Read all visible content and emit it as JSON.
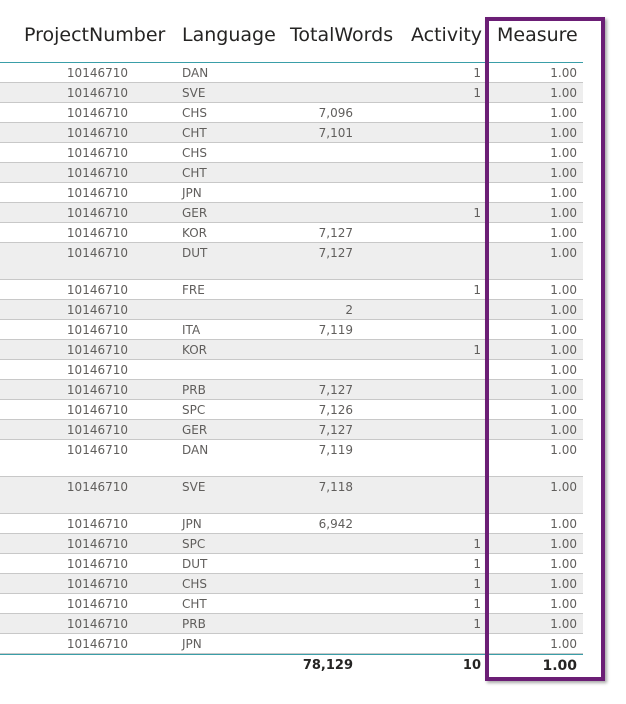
{
  "table": {
    "columns": {
      "project_number": "ProjectNumber",
      "language": "Language",
      "total_words": "TotalWords",
      "activity": "Activity",
      "measure": "Measure"
    },
    "rows": [
      {
        "project": "10146710",
        "language": "DAN",
        "words": "",
        "activity": "1",
        "measure": "1.00",
        "tall": false
      },
      {
        "project": "10146710",
        "language": "SVE",
        "words": "",
        "activity": "1",
        "measure": "1.00",
        "tall": false
      },
      {
        "project": "10146710",
        "language": "CHS",
        "words": "7,096",
        "activity": "",
        "measure": "1.00",
        "tall": false
      },
      {
        "project": "10146710",
        "language": "CHT",
        "words": "7,101",
        "activity": "",
        "measure": "1.00",
        "tall": false
      },
      {
        "project": "10146710",
        "language": "CHS",
        "words": "",
        "activity": "",
        "measure": "1.00",
        "tall": false
      },
      {
        "project": "10146710",
        "language": "CHT",
        "words": "",
        "activity": "",
        "measure": "1.00",
        "tall": false
      },
      {
        "project": "10146710",
        "language": "JPN",
        "words": "",
        "activity": "",
        "measure": "1.00",
        "tall": false
      },
      {
        "project": "10146710",
        "language": "GER",
        "words": "",
        "activity": "1",
        "measure": "1.00",
        "tall": false
      },
      {
        "project": "10146710",
        "language": "KOR",
        "words": "7,127",
        "activity": "",
        "measure": "1.00",
        "tall": false
      },
      {
        "project": "10146710",
        "language": "DUT",
        "words": "7,127",
        "activity": "",
        "measure": "1.00",
        "tall": true
      },
      {
        "project": "10146710",
        "language": "FRE",
        "words": "",
        "activity": "1",
        "measure": "1.00",
        "tall": false
      },
      {
        "project": "10146710",
        "language": "",
        "words": "2",
        "activity": "",
        "measure": "1.00",
        "tall": false
      },
      {
        "project": "10146710",
        "language": "ITA",
        "words": "7,119",
        "activity": "",
        "measure": "1.00",
        "tall": false
      },
      {
        "project": "10146710",
        "language": "KOR",
        "words": "",
        "activity": "1",
        "measure": "1.00",
        "tall": false
      },
      {
        "project": "10146710",
        "language": "",
        "words": "",
        "activity": "",
        "measure": "1.00",
        "tall": false
      },
      {
        "project": "10146710",
        "language": "PRB",
        "words": "7,127",
        "activity": "",
        "measure": "1.00",
        "tall": false
      },
      {
        "project": "10146710",
        "language": "SPC",
        "words": "7,126",
        "activity": "",
        "measure": "1.00",
        "tall": false
      },
      {
        "project": "10146710",
        "language": "GER",
        "words": "7,127",
        "activity": "",
        "measure": "1.00",
        "tall": false
      },
      {
        "project": "10146710",
        "language": "DAN",
        "words": "7,119",
        "activity": "",
        "measure": "1.00",
        "tall": true
      },
      {
        "project": "10146710",
        "language": "SVE",
        "words": "7,118",
        "activity": "",
        "measure": "1.00",
        "tall": true
      },
      {
        "project": "10146710",
        "language": "JPN",
        "words": "6,942",
        "activity": "",
        "measure": "1.00",
        "tall": false
      },
      {
        "project": "10146710",
        "language": "SPC",
        "words": "",
        "activity": "1",
        "measure": "1.00",
        "tall": false
      },
      {
        "project": "10146710",
        "language": "DUT",
        "words": "",
        "activity": "1",
        "measure": "1.00",
        "tall": false
      },
      {
        "project": "10146710",
        "language": "CHS",
        "words": "",
        "activity": "1",
        "measure": "1.00",
        "tall": false
      },
      {
        "project": "10146710",
        "language": "CHT",
        "words": "",
        "activity": "1",
        "measure": "1.00",
        "tall": false
      },
      {
        "project": "10146710",
        "language": "PRB",
        "words": "",
        "activity": "1",
        "measure": "1.00",
        "tall": false
      },
      {
        "project": "10146710",
        "language": "JPN",
        "words": "",
        "activity": "",
        "measure": "1.00",
        "tall": false
      }
    ],
    "totals": {
      "total_words": "78,129",
      "activity": "10",
      "measure": "1.00"
    }
  },
  "colors": {
    "highlight_border": "#6b1e75",
    "header_line": "#3a9ea8",
    "alt_row": "#eeeeee"
  }
}
